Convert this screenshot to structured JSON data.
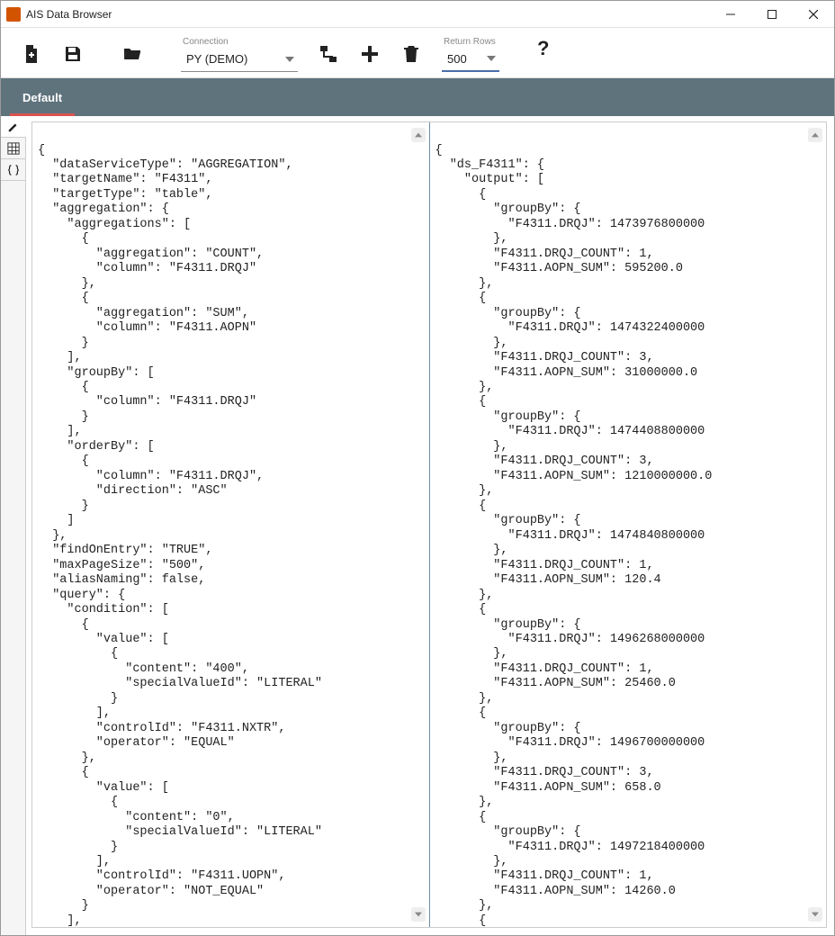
{
  "window": {
    "title": "AIS Data Browser"
  },
  "toolbar": {
    "connection_label": "Connection",
    "connection_value": "PY (DEMO)",
    "return_rows_label": "Return Rows",
    "return_rows_value": "500"
  },
  "tabs": {
    "default": "Default"
  },
  "left_pane_code": "{\n  \"dataServiceType\": \"AGGREGATION\",\n  \"targetName\": \"F4311\",\n  \"targetType\": \"table\",\n  \"aggregation\": {\n    \"aggregations\": [\n      {\n        \"aggregation\": \"COUNT\",\n        \"column\": \"F4311.DRQJ\"\n      },\n      {\n        \"aggregation\": \"SUM\",\n        \"column\": \"F4311.AOPN\"\n      }\n    ],\n    \"groupBy\": [\n      {\n        \"column\": \"F4311.DRQJ\"\n      }\n    ],\n    \"orderBy\": [\n      {\n        \"column\": \"F4311.DRQJ\",\n        \"direction\": \"ASC\"\n      }\n    ]\n  },\n  \"findOnEntry\": \"TRUE\",\n  \"maxPageSize\": \"500\",\n  \"aliasNaming\": false,\n  \"query\": {\n    \"condition\": [\n      {\n        \"value\": [\n          {\n            \"content\": \"400\",\n            \"specialValueId\": \"LITERAL\"\n          }\n        ],\n        \"controlId\": \"F4311.NXTR\",\n        \"operator\": \"EQUAL\"\n      },\n      {\n        \"value\": [\n          {\n            \"content\": \"0\",\n            \"specialValueId\": \"LITERAL\"\n          }\n        ],\n        \"controlId\": \"F4311.UOPN\",\n        \"operator\": \"NOT_EQUAL\"\n      }\n    ],",
  "right_pane_code": "{\n  \"ds_F4311\": {\n    \"output\": [\n      {\n        \"groupBy\": {\n          \"F4311.DRQJ\": 1473976800000\n        },\n        \"F4311.DRQJ_COUNT\": 1,\n        \"F4311.AOPN_SUM\": 595200.0\n      },\n      {\n        \"groupBy\": {\n          \"F4311.DRQJ\": 1474322400000\n        },\n        \"F4311.DRQJ_COUNT\": 3,\n        \"F4311.AOPN_SUM\": 31000000.0\n      },\n      {\n        \"groupBy\": {\n          \"F4311.DRQJ\": 1474408800000\n        },\n        \"F4311.DRQJ_COUNT\": 3,\n        \"F4311.AOPN_SUM\": 1210000000.0\n      },\n      {\n        \"groupBy\": {\n          \"F4311.DRQJ\": 1474840800000\n        },\n        \"F4311.DRQJ_COUNT\": 1,\n        \"F4311.AOPN_SUM\": 120.4\n      },\n      {\n        \"groupBy\": {\n          \"F4311.DRQJ\": 1496268000000\n        },\n        \"F4311.DRQJ_COUNT\": 1,\n        \"F4311.AOPN_SUM\": 25460.0\n      },\n      {\n        \"groupBy\": {\n          \"F4311.DRQJ\": 1496700000000\n        },\n        \"F4311.DRQJ_COUNT\": 3,\n        \"F4311.AOPN_SUM\": 658.0\n      },\n      {\n        \"groupBy\": {\n          \"F4311.DRQJ\": 1497218400000\n        },\n        \"F4311.DRQJ_COUNT\": 1,\n        \"F4311.AOPN_SUM\": 14260.0\n      },\n      {"
}
